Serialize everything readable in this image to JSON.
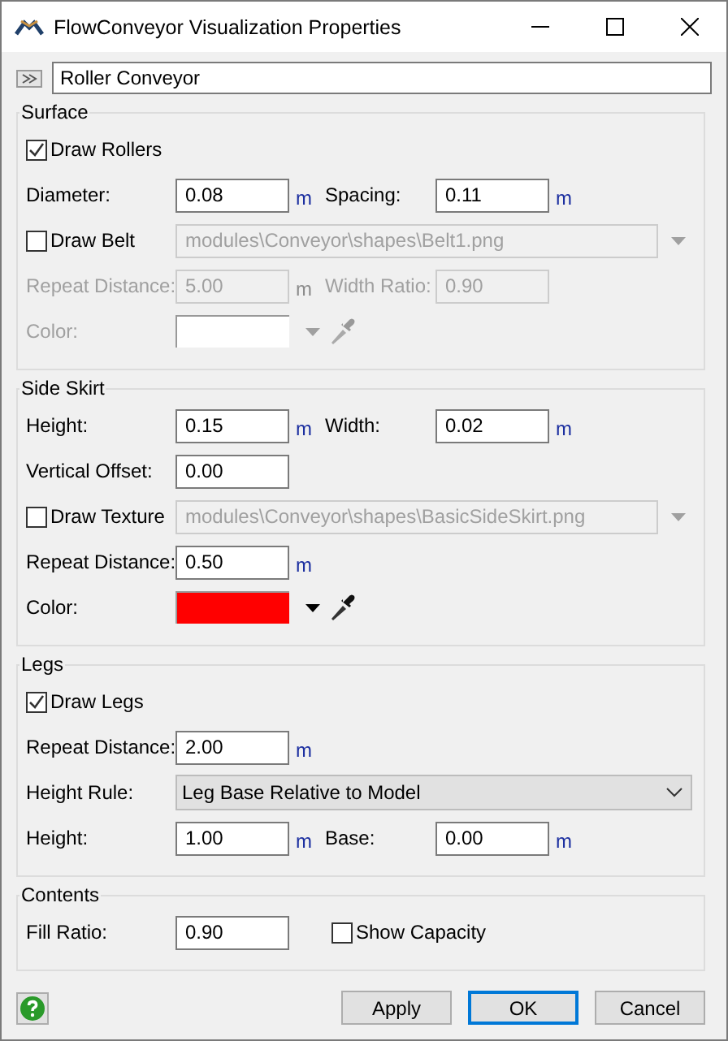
{
  "window": {
    "title": "FlowConveyor Visualization Properties"
  },
  "name_field": {
    "value": "Roller Conveyor"
  },
  "sections": [
    {
      "title": "Surface",
      "rows": [
        [
          {
            "kind": "checkbox",
            "label": "Draw Rollers",
            "checked": true,
            "disabled": false
          }
        ],
        [
          {
            "kind": "field",
            "label": "Diameter:",
            "value": "0.08",
            "unit": "m",
            "disabled": false
          },
          {
            "kind": "field",
            "label": "Spacing:",
            "value": "0.11",
            "unit": "m",
            "disabled": false
          }
        ],
        [
          {
            "kind": "checkbox",
            "label": "Draw Belt",
            "checked": false,
            "disabled": false
          },
          {
            "kind": "path",
            "value": "modules\\Conveyor\\shapes\\Belt1.png",
            "disabled": true
          }
        ],
        [
          {
            "kind": "field",
            "label": "Repeat Distance:",
            "value": "5.00",
            "unit": "m",
            "disabled": true
          },
          {
            "kind": "field",
            "label": "Width Ratio:",
            "value": "0.90",
            "disabled": true
          }
        ],
        [
          {
            "kind": "color",
            "label": "Color:",
            "color": "#ffffff",
            "disabled": true
          }
        ]
      ]
    },
    {
      "title": "Side Skirt",
      "rows": [
        [
          {
            "kind": "field",
            "label": "Height:",
            "value": "0.15",
            "unit": "m",
            "disabled": false
          },
          {
            "kind": "field",
            "label": "Width:",
            "value": "0.02",
            "unit": "m",
            "disabled": false
          }
        ],
        [
          {
            "kind": "field",
            "label": "Vertical Offset:",
            "value": "0.00",
            "disabled": false
          }
        ],
        [
          {
            "kind": "checkbox",
            "label": "Draw Texture",
            "checked": false,
            "disabled": false
          },
          {
            "kind": "path",
            "value": "modules\\Conveyor\\shapes\\BasicSideSkirt.png",
            "disabled": true
          }
        ],
        [
          {
            "kind": "field",
            "label": "Repeat Distance:",
            "value": "0.50",
            "unit": "m",
            "disabled": false
          }
        ],
        [
          {
            "kind": "color",
            "label": "Color:",
            "color": "#ff0000",
            "disabled": false
          }
        ]
      ]
    },
    {
      "title": "Legs",
      "rows": [
        [
          {
            "kind": "checkbox",
            "label": "Draw Legs",
            "checked": true,
            "disabled": false
          }
        ],
        [
          {
            "kind": "field",
            "label": "Repeat Distance:",
            "value": "2.00",
            "unit": "m",
            "disabled": false
          }
        ],
        [
          {
            "kind": "select",
            "label": "Height Rule:",
            "value": "Leg Base Relative to Model"
          }
        ],
        [
          {
            "kind": "field",
            "label": "Height:",
            "value": "1.00",
            "unit": "m",
            "disabled": false
          },
          {
            "kind": "field",
            "label": "Base:",
            "value": "0.00",
            "unit": "m",
            "disabled": false
          }
        ]
      ]
    },
    {
      "title": "Contents",
      "rows": [
        [
          {
            "kind": "field",
            "label": "Fill Ratio:",
            "value": "0.90",
            "disabled": false
          },
          {
            "kind": "checkbox",
            "label": "Show Capacity",
            "checked": false,
            "disabled": false
          }
        ]
      ]
    }
  ],
  "buttons": [
    {
      "label": "Apply",
      "default": false
    },
    {
      "label": "OK",
      "default": true
    },
    {
      "label": "Cancel",
      "default": false
    }
  ]
}
